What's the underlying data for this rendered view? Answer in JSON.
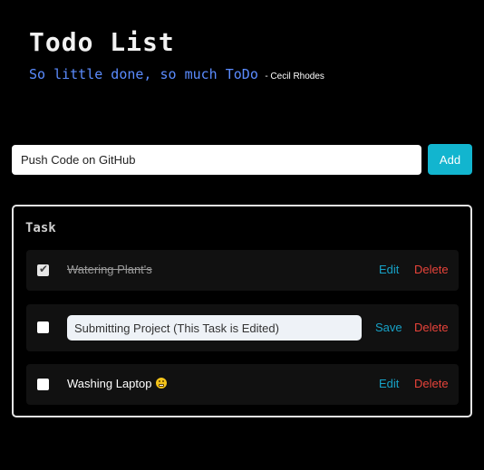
{
  "header": {
    "title": "Todo List",
    "quote": "So little done, so much ToDo",
    "author": "- Cecil Rhodes"
  },
  "new_task": {
    "value": "Push Code on GitHub",
    "add_label": "Add"
  },
  "panel": {
    "heading": "Task",
    "tasks": [
      {
        "text": "Watering Plant's",
        "completed": true,
        "editing": false,
        "primary_action": "Edit",
        "delete_label": "Delete"
      },
      {
        "text": "Submitting Project (This Task is Edited)",
        "completed": false,
        "editing": true,
        "primary_action": "Save",
        "delete_label": "Delete"
      },
      {
        "text": "Washing Laptop",
        "emoji": "grimacing-face-emoji",
        "completed": false,
        "editing": false,
        "primary_action": "Edit",
        "delete_label": "Delete"
      }
    ]
  },
  "colors": {
    "background": "#000000",
    "quote": "#5b8cff",
    "accent": "#12b5cf",
    "link": "#17a2c7",
    "danger": "#e8433a"
  }
}
